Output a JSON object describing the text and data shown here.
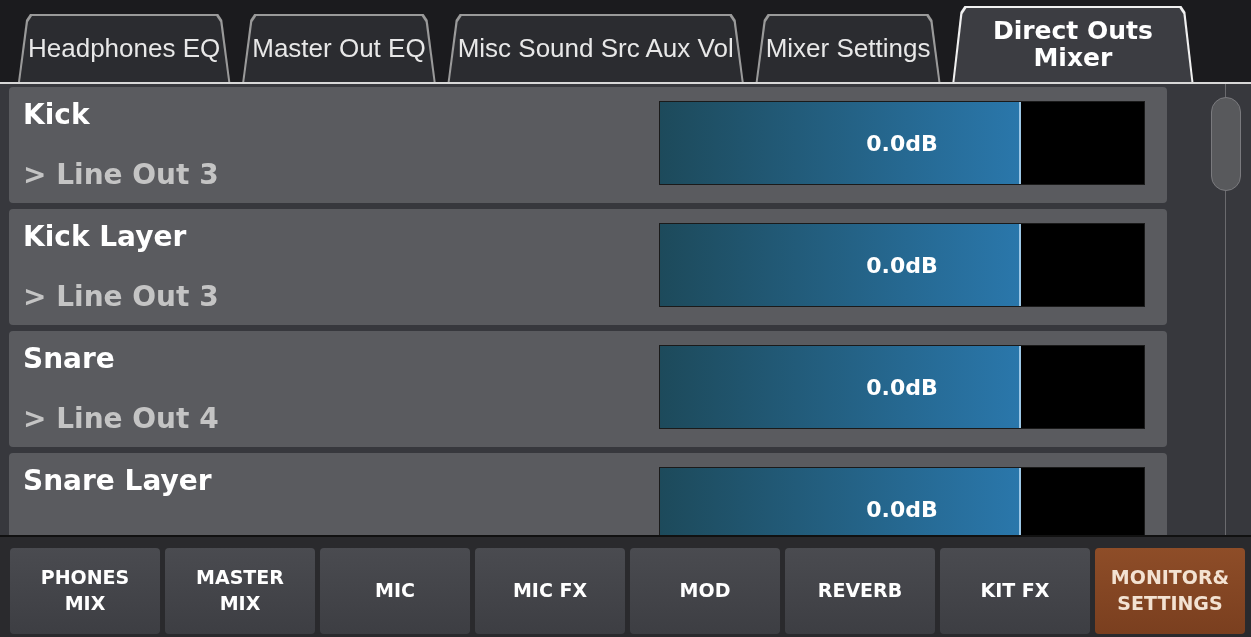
{
  "tabs": [
    {
      "label": "Headphones EQ",
      "selected": false
    },
    {
      "label": "Master Out EQ",
      "selected": false
    },
    {
      "label": "Misc Sound Src Aux Vol",
      "selected": false
    },
    {
      "label": "Mixer Settings",
      "selected": false
    },
    {
      "label": "Direct Outs Mixer",
      "selected": true
    }
  ],
  "channels": [
    {
      "name": "Kick",
      "output": "> Line Out 3",
      "level": 0.746,
      "reading": "0.0dB"
    },
    {
      "name": "Kick Layer",
      "output": "> Line Out 3",
      "level": 0.746,
      "reading": "0.0dB"
    },
    {
      "name": "Snare",
      "output": "> Line Out 4",
      "level": 0.746,
      "reading": "0.0dB"
    },
    {
      "name": "Snare Layer",
      "level": 0.746,
      "reading": "0.0dB"
    }
  ],
  "nav_buttons": [
    {
      "label": "PHONES MIX",
      "selected": false
    },
    {
      "label": "MASTER MIX",
      "selected": false
    },
    {
      "label": "MIC",
      "selected": false
    },
    {
      "label": "MIC FX",
      "selected": false
    },
    {
      "label": "MOD",
      "selected": false
    },
    {
      "label": "REVERB",
      "selected": false
    },
    {
      "label": "KIT FX",
      "selected": false
    },
    {
      "label": "MONITOR& SETTINGS",
      "selected": true
    }
  ]
}
